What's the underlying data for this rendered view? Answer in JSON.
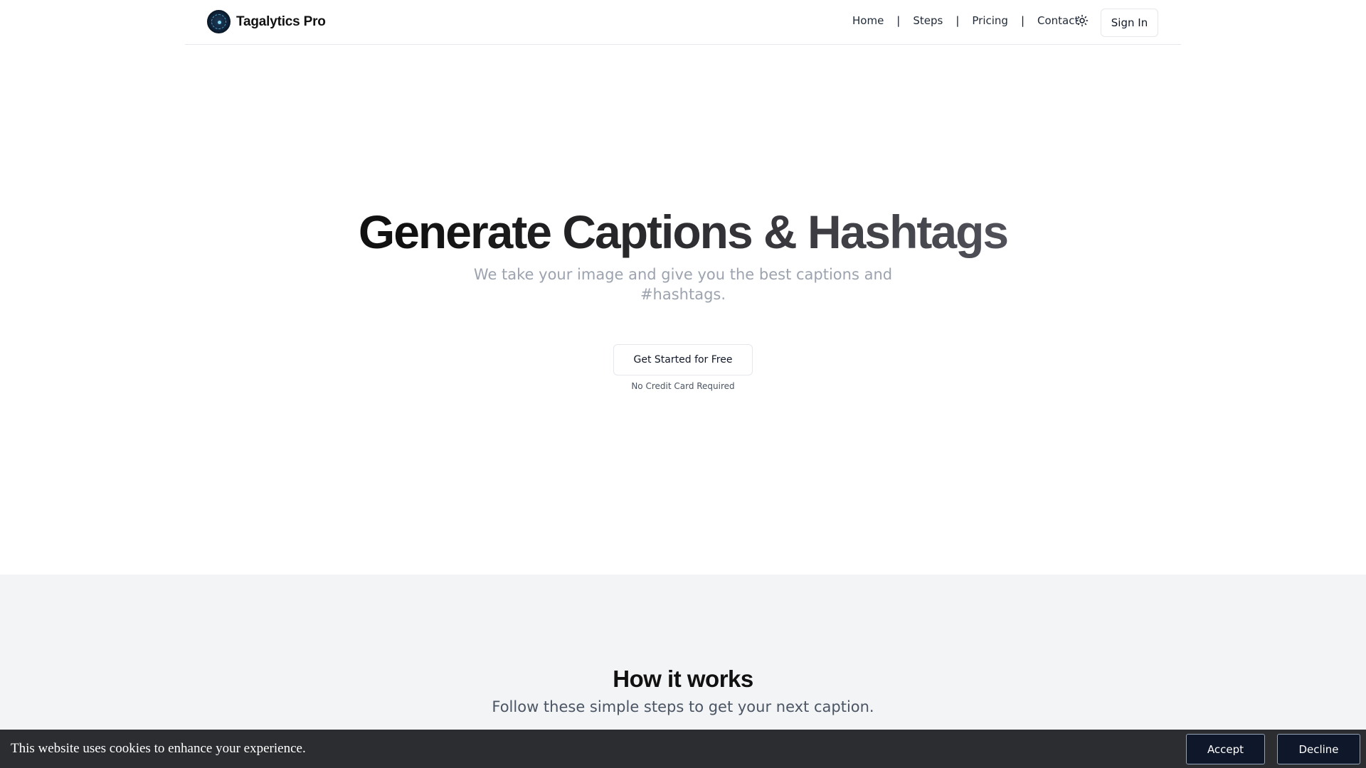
{
  "header": {
    "brand_name": "Tagalytics Pro",
    "logo_icon": "tagalytics-logo-icon",
    "nav": [
      {
        "label": "Home"
      },
      {
        "label": "Steps"
      },
      {
        "label": "Pricing"
      },
      {
        "label": "Contact"
      }
    ],
    "separator": "|",
    "theme_icon": "sun-icon",
    "signin_label": "Sign In"
  },
  "hero": {
    "title": "Generate Captions & Hashtags",
    "subtitle": "We take your image and give you the best captions and #hashtags.",
    "cta_label": "Get Started for Free",
    "cta_note": "No Credit Card Required"
  },
  "how_it_works": {
    "title": "How it works",
    "subtitle": "Follow these simple steps to get your next caption."
  },
  "cookie_banner": {
    "message": "This website uses cookies to enhance your experience.",
    "accept_label": "Accept",
    "decline_label": "Decline"
  },
  "colors": {
    "background": "#ffffff",
    "section_alt": "#f3f4f6",
    "cookie_bar": "#2b2d30",
    "cookie_button": "#0f172a",
    "muted_text": "#9ca3af"
  }
}
